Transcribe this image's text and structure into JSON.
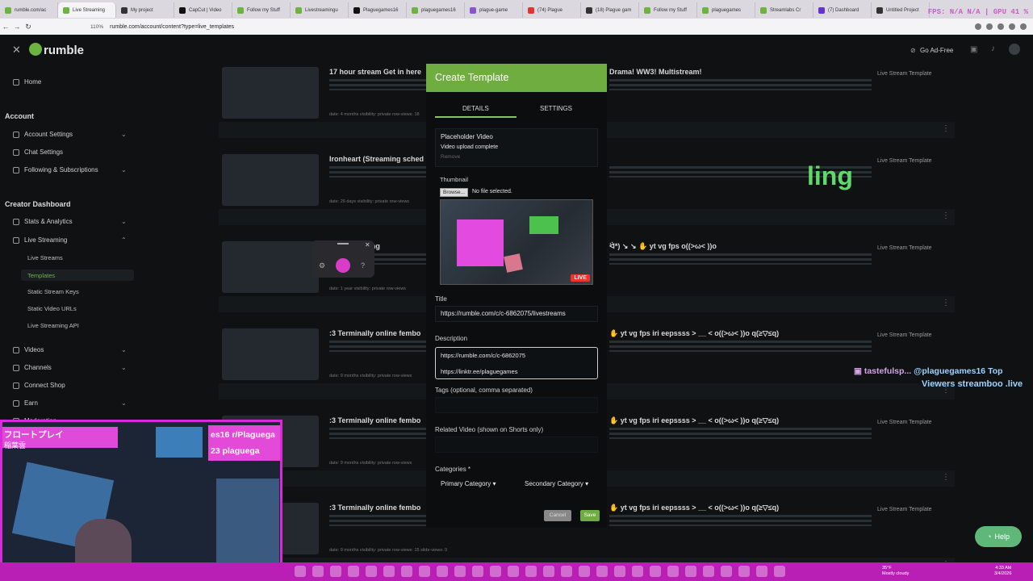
{
  "browser": {
    "tabs": [
      {
        "title": "rumble.com/ac",
        "color": "#6cb33f"
      },
      {
        "title": "Live Streaming",
        "color": "#6cb33f",
        "active": true
      },
      {
        "title": "My project",
        "color": "#333333"
      },
      {
        "title": "CapCut | Video",
        "color": "#111111"
      },
      {
        "title": "Follow my Stuff",
        "color": "#6cb33f"
      },
      {
        "title": "Livestreamingu",
        "color": "#6cb33f"
      },
      {
        "title": "Plaguegames16",
        "color": "#111111"
      },
      {
        "title": "plaguegames16",
        "color": "#6cb33f"
      },
      {
        "title": "plague-game",
        "color": "#8855cc"
      },
      {
        "title": "(74) Plague",
        "color": "#e33333"
      },
      {
        "title": "(18) Plague gam",
        "color": "#333333"
      },
      {
        "title": "Follow my Stuff",
        "color": "#6cb33f"
      },
      {
        "title": "plaguegames",
        "color": "#6cb33f"
      },
      {
        "title": "Streamlabs Cr",
        "color": "#6cb33f"
      },
      {
        "title": "(7) Dashboard",
        "color": "#6633cc"
      },
      {
        "title": "Untitled Project",
        "color": "#333333"
      }
    ],
    "overlay_stats": "FPS: N/A  N/A | GPU 41 %",
    "zoom": "110%",
    "url": "rumble.com/account/content?type=live_templates"
  },
  "header": {
    "logo": "rumble",
    "go_ad_free": "Go Ad-Free"
  },
  "sidebar": {
    "home": "Home",
    "account_section": "Account",
    "account_settings": "Account Settings",
    "chat_settings": "Chat Settings",
    "following": "Following & Subscriptions",
    "creator_section": "Creator Dashboard",
    "stats": "Stats & Analytics",
    "live_streaming": "Live Streaming",
    "live_streams": "Live Streams",
    "templates": "Templates",
    "static_keys": "Static Stream Keys",
    "static_urls": "Static Video URLs",
    "api": "Live Streaming API",
    "videos": "Videos",
    "channels": "Channels",
    "connect_shop": "Connect Shop",
    "earn": "Earn",
    "moderation": "Moderation"
  },
  "rows": [
    {
      "title": "17 hour stream Get in here",
      "right_title": "Drama! WW3! Multistream!",
      "meta": "date: 4 months   visibility: private   row-views: 18",
      "type": "Live Stream Template"
    },
    {
      "title": "Ironheart (Streaming sched",
      "right_title": "",
      "meta": "date: 26 days   visibility: private   row-views",
      "type": "Live Stream Template"
    },
    {
      "title": "im just Testing",
      "right_title": "ᐛ*) ↘ ↘ ✋ yt vg fps o((>ω< ))o",
      "meta": "date: 1 year   visibility: private   row-views",
      "type": "Live Stream Template"
    },
    {
      "title": ":3 Terminally online fembo",
      "right_title": "✋ yt vg fps iri eepssss > __ < o((>ω< ))o q(≥▽≤q)",
      "meta": "date: 9 months   visibility: private   row-views",
      "type": "Live Stream Template"
    },
    {
      "title": ":3 Terminally online fembo",
      "right_title": "✋ yt vg fps iri eepssss > __ < o((>ω< ))o q(≥▽≤q)",
      "meta": "date: 9 months   visibility: private   row-views",
      "type": "Live Stream Template"
    },
    {
      "title": ":3 Terminally online fembo",
      "right_title": "✋ yt vg fps iri eepssss > __ < o((>ω< ))o q(≥▽≤q)",
      "meta": "date: 9 months   visibility: private   row-views: 15   slide-views: 0",
      "type": "Live Stream Template"
    }
  ],
  "modal": {
    "title": "Create Template",
    "tab_details": "DETAILS",
    "tab_settings": "SETTINGS",
    "placeholder_video": "Placeholder Video",
    "upload_status": "Video upload complete",
    "remove": "Remove",
    "thumbnail_label": "Thumbnail",
    "browse": "Browse...",
    "no_file": "No file selected.",
    "live_badge": "LIVE",
    "title_label": "Title",
    "title_value": "https://rumble.com/c/c-6862075/livestreams",
    "description_label": "Description",
    "description_line1": "https://rumble.com/c/c-6862075",
    "description_line2": "https://linktr.ee/plaguegames",
    "tags_label": "Tags (optional, comma separated)",
    "related_label": "Related Video (shown on Shorts only)",
    "categories_label": "Categories *",
    "primary_category": "Primary Category",
    "secondary_category": "Secondary Category",
    "cancel": "Cancel",
    "save": "Save"
  },
  "overlays": {
    "ling_text": "ling",
    "chat_user": "tastefulsp...",
    "chat_msg": "@plaguegames16 Top",
    "chat_msg2": "Viewers streamboo .live",
    "cam_text1": "フロートプレイ",
    "cam_text2": "稲葉雲",
    "cam_tag1": "es16 r/Plaguega",
    "cam_tag2": "23 plaguega",
    "help": "Help"
  },
  "taskbar": {
    "weather_temp": "35°F",
    "weather_desc": "Mostly cloudy",
    "time": "4:33 AM",
    "date": "3/4/2026"
  }
}
